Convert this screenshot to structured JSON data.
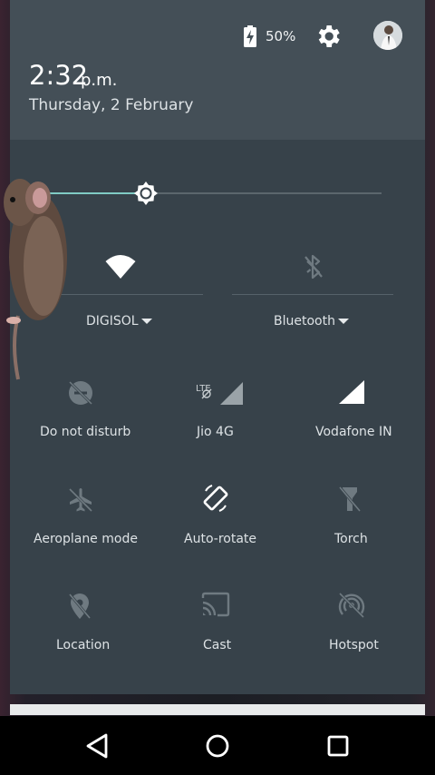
{
  "status": {
    "battery_percent": "50%",
    "battery_level": 0.5
  },
  "header": {
    "time": "2:32",
    "ampm": "p.m.",
    "date": "Thursday, 2 February"
  },
  "brightness": {
    "level": 0.3
  },
  "tiles_top": {
    "wifi": {
      "label": "DIGISOL",
      "icon": "wifi-icon"
    },
    "bluetooth": {
      "label": "Bluetooth",
      "icon": "bluetooth-off-icon"
    }
  },
  "tiles": [
    {
      "label": "Do not disturb",
      "icon": "do-not-disturb-off-icon"
    },
    {
      "label": "Jio 4G",
      "icon": "signal-lte-icon"
    },
    {
      "label": "Vodafone IN",
      "icon": "signal-icon"
    },
    {
      "label": "Aeroplane mode",
      "icon": "airplane-off-icon"
    },
    {
      "label": "Auto-rotate",
      "icon": "auto-rotate-icon"
    },
    {
      "label": "Torch",
      "icon": "torch-off-icon"
    },
    {
      "label": "Location",
      "icon": "location-off-icon"
    },
    {
      "label": "Cast",
      "icon": "cast-icon"
    },
    {
      "label": "Hotspot",
      "icon": "hotspot-off-icon"
    }
  ],
  "navbar": {
    "back": "back-icon",
    "home": "home-icon",
    "recents": "recents-icon"
  },
  "colors": {
    "panel": "#37424a",
    "header": "#444f57",
    "accent": "#80cbc4",
    "icon_dim": "#6f7a81",
    "icon_active": "#ffffff"
  }
}
